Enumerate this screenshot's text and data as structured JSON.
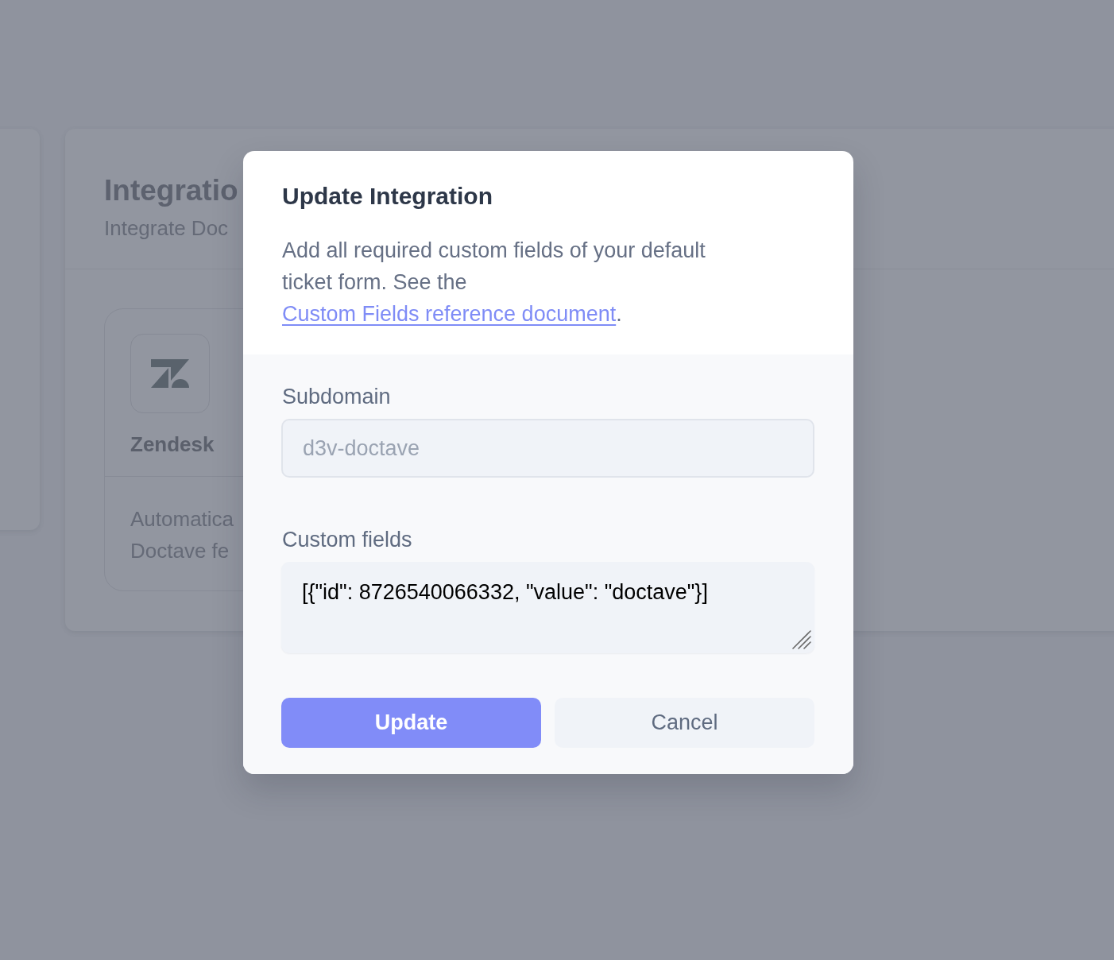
{
  "background": {
    "page_header": {
      "title": "Integratio",
      "subtitle": "Integrate Doc"
    },
    "integration_card": {
      "name": "Zendesk",
      "description": [
        "Automatica",
        "Doctave fe"
      ]
    }
  },
  "dialog": {
    "title": "Update Integration",
    "description": {
      "text": "Add all required custom fields of your default ticket form. See the ",
      "link": "Custom Fields reference document",
      "after": "."
    },
    "fields": [
      {
        "kind": "input",
        "label": "Subdomain",
        "value": "d3v-doctave",
        "disabled": true
      },
      {
        "kind": "textarea",
        "label": "Custom fields",
        "value": "[{\"id\": 8726540066332, \"value\": \"doctave\"}]",
        "disabled": false
      }
    ],
    "buttons": [
      {
        "label": "Update",
        "kind": "primary"
      },
      {
        "label": "Cancel",
        "kind": "secondary"
      }
    ]
  }
}
